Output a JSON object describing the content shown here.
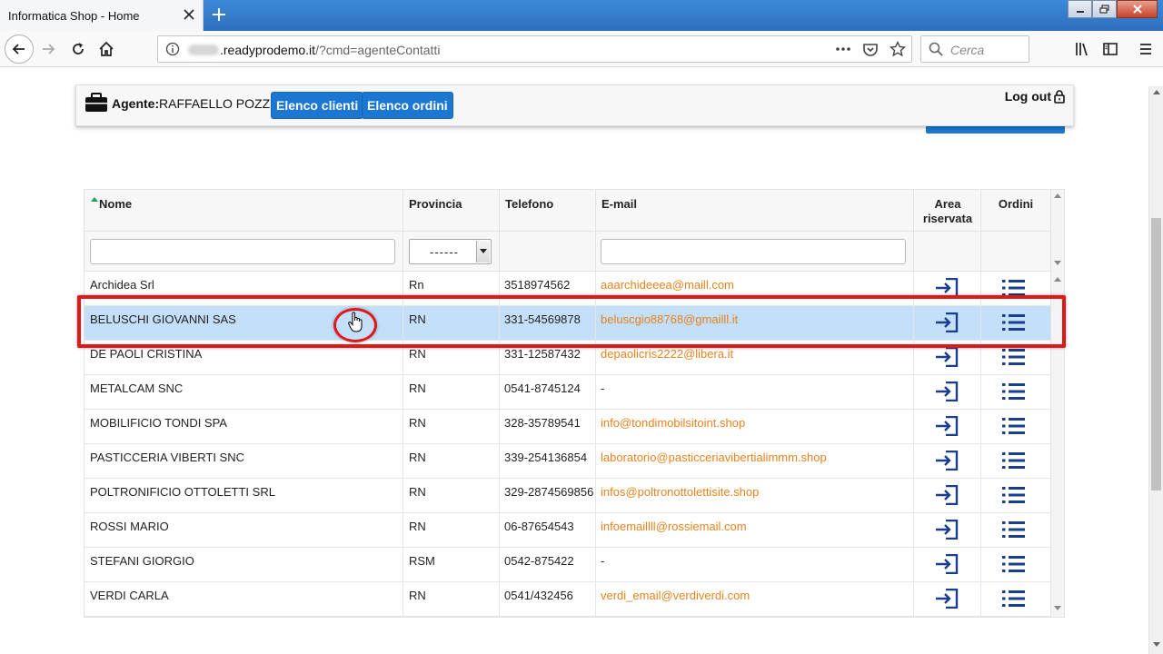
{
  "browser": {
    "tab_title": "Informatica Shop - Home",
    "url_host": ".readyprodemo.it",
    "url_path": "/?cmd=agenteContatti",
    "search_placeholder": "Cerca"
  },
  "agent_bar": {
    "agent_label": "Agente:",
    "agent_name": "RAFFAELLO POZZI",
    "btn_clients": "Elenco clienti",
    "btn_orders": "Elenco ordini",
    "logout": "Log out"
  },
  "table": {
    "columns": {
      "nome": "Nome",
      "provincia": "Provincia",
      "telefono": "Telefono",
      "email": "E-mail",
      "area_1": "Area",
      "area_2": "riservata",
      "ordini": "Ordini"
    },
    "filter_provincia": "------",
    "rows": [
      {
        "nome": "Archidea Srl",
        "provincia": "Rn",
        "telefono": "3518974562",
        "email": "aaarchideeea@maill.com"
      },
      {
        "nome": "BELUSCHI GIOVANNI SAS",
        "provincia": "RN",
        "telefono": "331-54569878",
        "email": "beluscgio88768@gmailll.it"
      },
      {
        "nome": "DE PAOLI CRISTINA",
        "provincia": "RN",
        "telefono": "331-12587432",
        "email": "depaolicris2222@libera.it"
      },
      {
        "nome": "METALCAM SNC",
        "provincia": "RN",
        "telefono": "0541-8745124",
        "email": "-"
      },
      {
        "nome": "MOBILIFICIO TONDI SPA",
        "provincia": "RN",
        "telefono": "328-35789541",
        "email": "info@tondimobilsitoint.shop"
      },
      {
        "nome": "PASTICCERIA VIBERTI SNC",
        "provincia": "RN",
        "telefono": "339-254136854",
        "email": "laboratorio@pasticceriavibertialimmm.shop"
      },
      {
        "nome": "POLTRONIFICIO OTTOLETTI SRL",
        "provincia": "RN",
        "telefono": "329-2874569856",
        "email": "infos@poltronottolettisite.shop"
      },
      {
        "nome": "ROSSI MARIO",
        "provincia": "RN",
        "telefono": "06-87654543",
        "email": "infoemaillll@rossiemail.com"
      },
      {
        "nome": "STEFANI GIORGIO",
        "provincia": "RSM",
        "telefono": "0542-875422",
        "email": "-"
      },
      {
        "nome": "VERDI CARLA",
        "provincia": "RN",
        "telefono": "0541/432456",
        "email": "verdi_email@verdiverdi.com"
      }
    ],
    "selected_row": 1
  },
  "colors": {
    "accent_blue": "#1b77d2",
    "email_orange": "#e8821e",
    "selection": "#c4dffa",
    "highlight_red": "#e01818",
    "icon_navy": "#1a3e8c"
  }
}
